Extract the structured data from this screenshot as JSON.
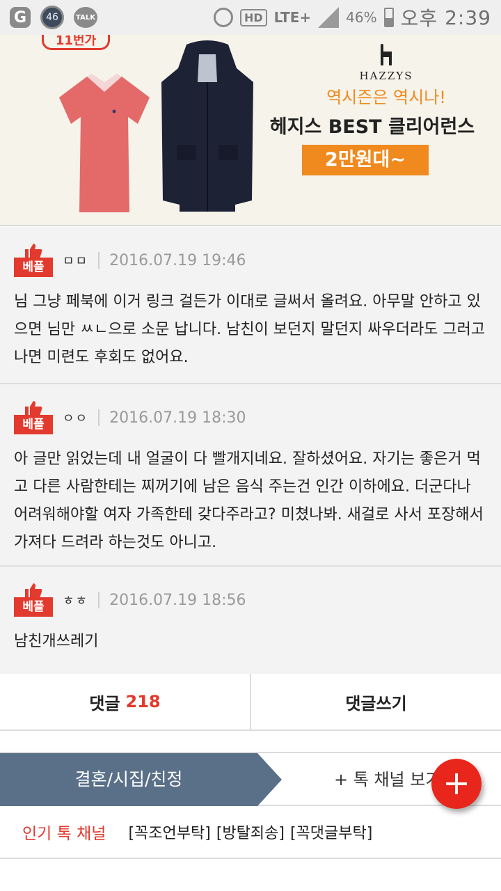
{
  "status_bar": {
    "badge_count": "46",
    "talk_label": "TALK",
    "hd_label": "HD",
    "network_label": "LTE+",
    "battery_text": "46%",
    "battery_level": 0.46,
    "ampm": "오후",
    "time": "2:39"
  },
  "ad": {
    "corner_tag": "11번가",
    "brand_name": "HAZZYS",
    "slogan": "역시즌은 역시나!",
    "title": "헤지스 BEST 클리어런스",
    "cta": "2만원대~",
    "colors": {
      "accent": "#f08a1e",
      "background": "#f5f3ea"
    }
  },
  "comments": [
    {
      "badge": "베플",
      "user": "ㅁㅁ",
      "date": "2016.07.19 19:46",
      "text": "님 그냥 페북에 이거 링크 걸든가 이대로 글써서 올려요. 아무말 안하고 있으면 님만 ㅆㄴ으로 소문 납니다. 남친이 보던지 말던지 싸우더라도 그러고나면 미련도 후회도 없어요."
    },
    {
      "badge": "베플",
      "user": "ㅇㅇ",
      "date": "2016.07.19 18:30",
      "text": "아 글만 읽었는데 내 얼굴이 다 빨개지네요. 잘하셨어요. 자기는 좋은거 먹고 다른 사람한테는 찌꺼기에 남은 음식 주는건 인간 이하에요. 더군다나 어려워해야할 여자 가족한테 갖다주라고? 미쳤나봐. 새걸로 사서 포장해서 가져다 드려라 하는것도 아니고."
    },
    {
      "badge": "베플",
      "user": "ㅎㅎ",
      "date": "2016.07.19 18:56",
      "text": "남친개쓰레기"
    }
  ],
  "actions": {
    "comments_label": "댓글",
    "comments_count": "218",
    "write_label": "댓글쓰기"
  },
  "channel": {
    "current": "결혼/시집/친정",
    "more_label": "+ 톡 채널 보기"
  },
  "popular": {
    "label": "인기 톡 채널",
    "tags": [
      "[꼭조언부탁]",
      "[방탈죄송]",
      "[꼭댓글부탁]"
    ]
  },
  "colors": {
    "brand_red": "#e23a2e",
    "channel_tab": "#5a7088",
    "fab": "#e8261c"
  },
  "icons": {
    "best_badge": "thumbs-up-icon",
    "fab": "plus-icon"
  }
}
